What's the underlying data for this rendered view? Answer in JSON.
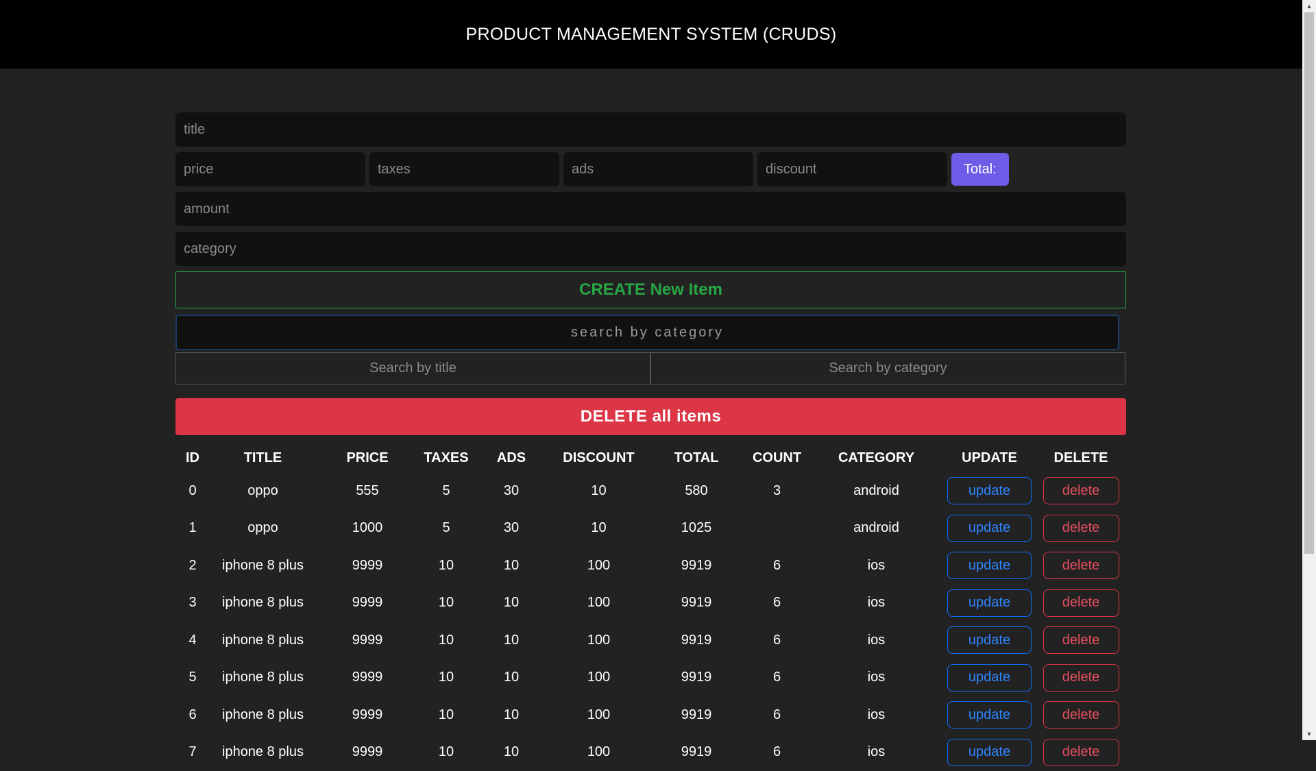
{
  "header": {
    "title": "PRODUCT MANAGEMENT SYSTEM (CRUDS)"
  },
  "form": {
    "title_placeholder": "title",
    "price_placeholder": "price",
    "taxes_placeholder": "taxes",
    "ads_placeholder": "ads",
    "discount_placeholder": "discount",
    "total_label": "Total:",
    "amount_placeholder": "amount",
    "category_placeholder": "category",
    "create_label": "CREATE New Item"
  },
  "search": {
    "placeholder": "search by category",
    "by_title_label": "Search by title",
    "by_category_label": "Search by category"
  },
  "delete_all_label": "DELETE all items",
  "table": {
    "headers": [
      "ID",
      "TITLE",
      "PRICE",
      "TAXES",
      "ADS",
      "DISCOUNT",
      "TOTAL",
      "COUNT",
      "CATEGORY",
      "UPDATE",
      "DELETE"
    ],
    "update_label": "update",
    "delete_label": "delete",
    "rows": [
      {
        "id": "0",
        "title": "oppo",
        "price": "555",
        "taxes": "5",
        "ads": "30",
        "discount": "10",
        "total": "580",
        "count": "3",
        "category": "android"
      },
      {
        "id": "1",
        "title": "oppo",
        "price": "1000",
        "taxes": "5",
        "ads": "30",
        "discount": "10",
        "total": "1025",
        "count": "",
        "category": "android"
      },
      {
        "id": "2",
        "title": "iphone 8 plus",
        "price": "9999",
        "taxes": "10",
        "ads": "10",
        "discount": "100",
        "total": "9919",
        "count": "6",
        "category": "ios"
      },
      {
        "id": "3",
        "title": "iphone 8 plus",
        "price": "9999",
        "taxes": "10",
        "ads": "10",
        "discount": "100",
        "total": "9919",
        "count": "6",
        "category": "ios"
      },
      {
        "id": "4",
        "title": "iphone 8 plus",
        "price": "9999",
        "taxes": "10",
        "ads": "10",
        "discount": "100",
        "total": "9919",
        "count": "6",
        "category": "ios"
      },
      {
        "id": "5",
        "title": "iphone 8 plus",
        "price": "9999",
        "taxes": "10",
        "ads": "10",
        "discount": "100",
        "total": "9919",
        "count": "6",
        "category": "ios"
      },
      {
        "id": "6",
        "title": "iphone 8 plus",
        "price": "9999",
        "taxes": "10",
        "ads": "10",
        "discount": "100",
        "total": "9919",
        "count": "6",
        "category": "ios"
      },
      {
        "id": "7",
        "title": "iphone 8 plus",
        "price": "9999",
        "taxes": "10",
        "ads": "10",
        "discount": "100",
        "total": "9919",
        "count": "6",
        "category": "ios"
      }
    ]
  },
  "icons": {
    "scroll_up": "scroll-up-arrow-icon",
    "scroll_down": "scroll-down-arrow-icon"
  },
  "colors": {
    "background": "#222222",
    "header": "#000000",
    "create": "#28a745",
    "delete": "#dc3545",
    "update": "#0d6efd",
    "total": "#6c5ce7"
  }
}
